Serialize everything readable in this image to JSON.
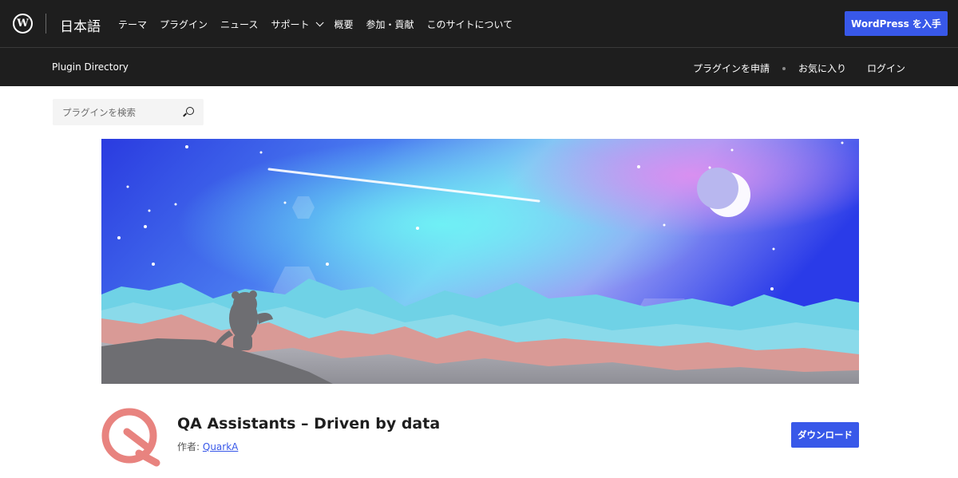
{
  "header": {
    "logo_letter": "W",
    "locale": "日本語",
    "nav": [
      {
        "label": "テーマ"
      },
      {
        "label": "プラグイン"
      },
      {
        "label": "ニュース"
      },
      {
        "label": "サポート"
      },
      {
        "label": "概要"
      },
      {
        "label": "参加・貢献"
      },
      {
        "label": "このサイトについて"
      }
    ],
    "get_wordpress": "WordPress を入手"
  },
  "subheader": {
    "title": "Plugin Directory",
    "submit": "プラグインを申請",
    "favorites": "お気に入り",
    "login": "ログイン"
  },
  "search": {
    "placeholder": "プラグインを検索"
  },
  "plugin": {
    "title": "QA Assistants – Driven by data",
    "author_prefix": "作者:",
    "author_name": "QuarkA",
    "download": "ダウンロード"
  },
  "colors": {
    "header_bg": "#1e1e1e",
    "accent": "#3858e9",
    "icon": "#e8837f"
  },
  "icons": [
    "wordpress-logo-icon",
    "chevron-down-icon",
    "search-icon",
    "plugin-q-icon"
  ]
}
